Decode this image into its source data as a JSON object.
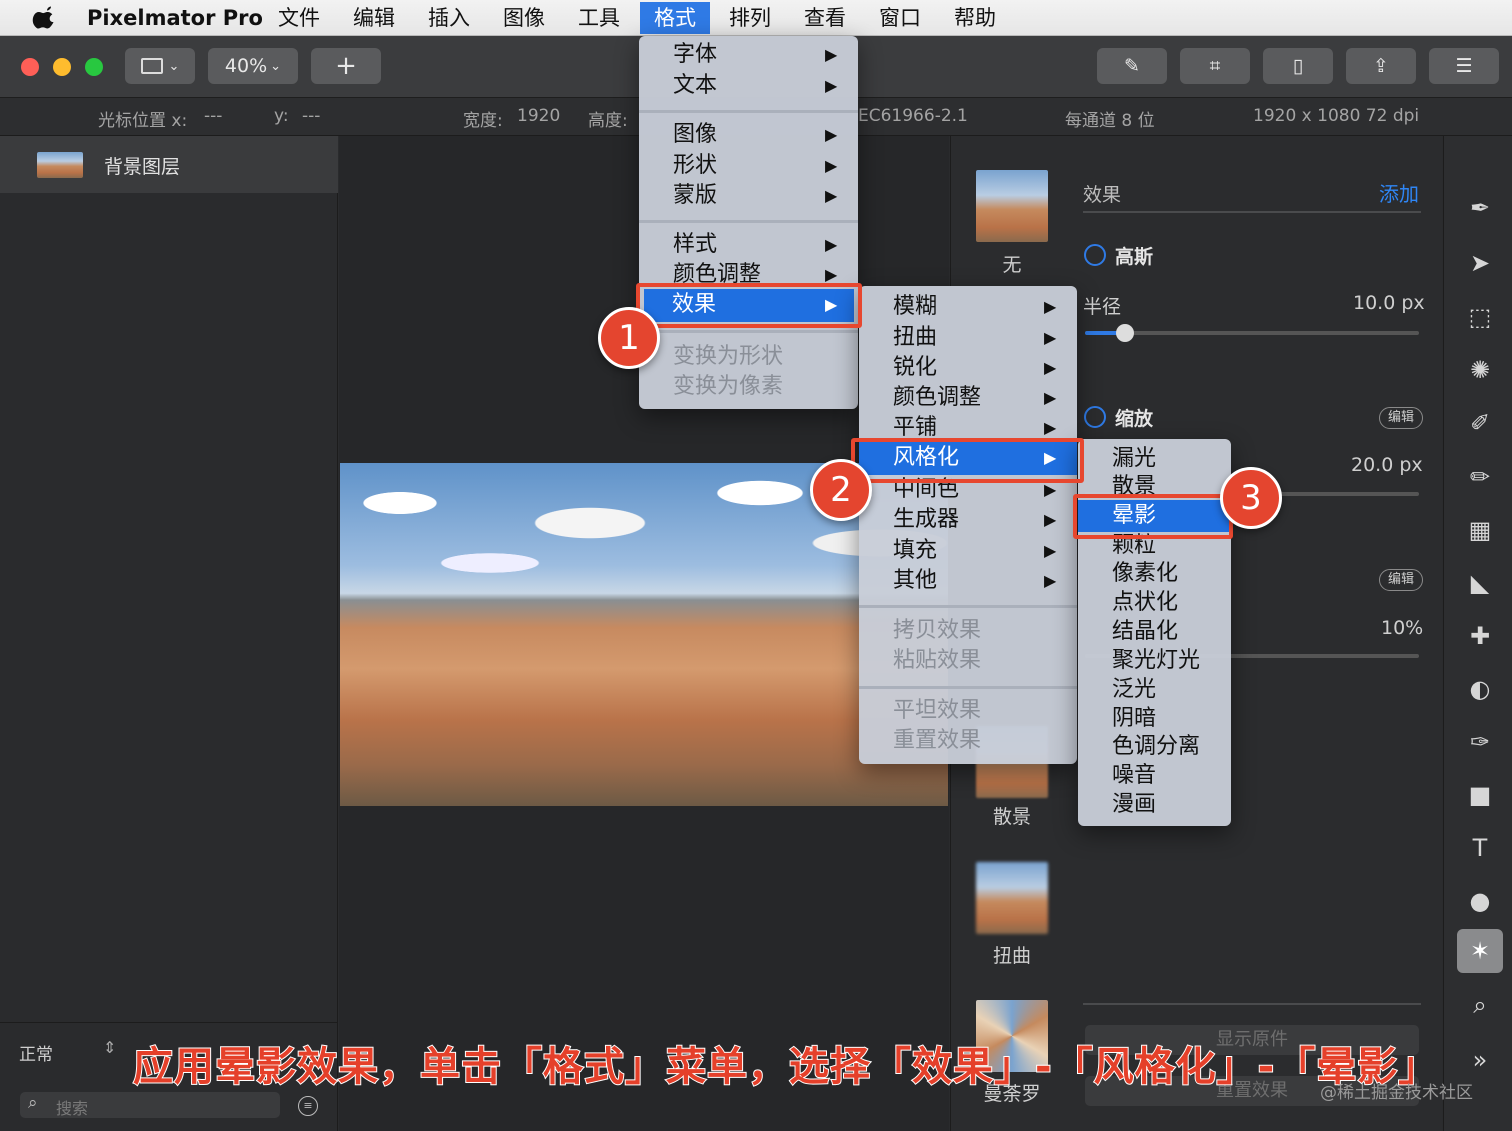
{
  "menubar": {
    "app_name": "Pixelmator Pro",
    "items": [
      "文件",
      "编辑",
      "插入",
      "图像",
      "工具",
      "格式",
      "排列",
      "查看",
      "窗口",
      "帮助"
    ],
    "active_item": "格式"
  },
  "toolbar": {
    "zoom": "40%",
    "add_label": "+"
  },
  "infobar": {
    "cursor_x_label": "光标位置 x:",
    "cursor_x_value": "---",
    "cursor_y_label": "y:",
    "cursor_y_value": "---",
    "width_label": "宽度:",
    "width_value": "1920",
    "height_label": "高度:",
    "color_profile": "EC61966-2.1",
    "bit_depth": "每通道 8 位",
    "dimensions": "1920 x 1080 72 dpi"
  },
  "layers": {
    "layer_name": "背景图层",
    "blend_mode": "正常",
    "search_placeholder": "搜索"
  },
  "format_menu": {
    "items": [
      "字体",
      "文本",
      "图像",
      "形状",
      "蒙版",
      "样式",
      "颜色调整",
      "效果",
      "变换为形状",
      "变换为像素"
    ]
  },
  "effects_submenu": {
    "items": [
      "模糊",
      "扭曲",
      "锐化",
      "颜色调整",
      "平铺",
      "风格化",
      "中间色",
      "生成器",
      "填充",
      "其他",
      "拷贝效果",
      "粘贴效果",
      "平坦效果",
      "重置效果"
    ]
  },
  "stylize_submenu": {
    "items": [
      "漏光",
      "散景",
      "晕影",
      "颗粒",
      "像素化",
      "点状化",
      "结晶化",
      "聚光灯光",
      "泛光",
      "阴暗",
      "色调分离",
      "噪音",
      "漫画"
    ]
  },
  "effects_panel": {
    "title": "效果",
    "add_label": "添加",
    "thumbs": [
      "无",
      "散景",
      "扭曲",
      "曼荼罗"
    ],
    "effect1_name": "高斯",
    "radius_label": "半径",
    "radius_value": "10.0 px",
    "radius_fraction": 0.12,
    "effect2_name": "缩放",
    "edit_label": "编辑",
    "value2": "20.0 px",
    "value3": "10%",
    "show_original": "显示原件",
    "reset_effects": "重置效果"
  },
  "annotations": {
    "badge1": "1",
    "badge2": "2",
    "badge3": "3",
    "caption": "应用晕影效果，单击「格式」菜单，选择「效果」-「风格化」-「晕影」",
    "watermark": "@稀土掘金技术社区"
  }
}
